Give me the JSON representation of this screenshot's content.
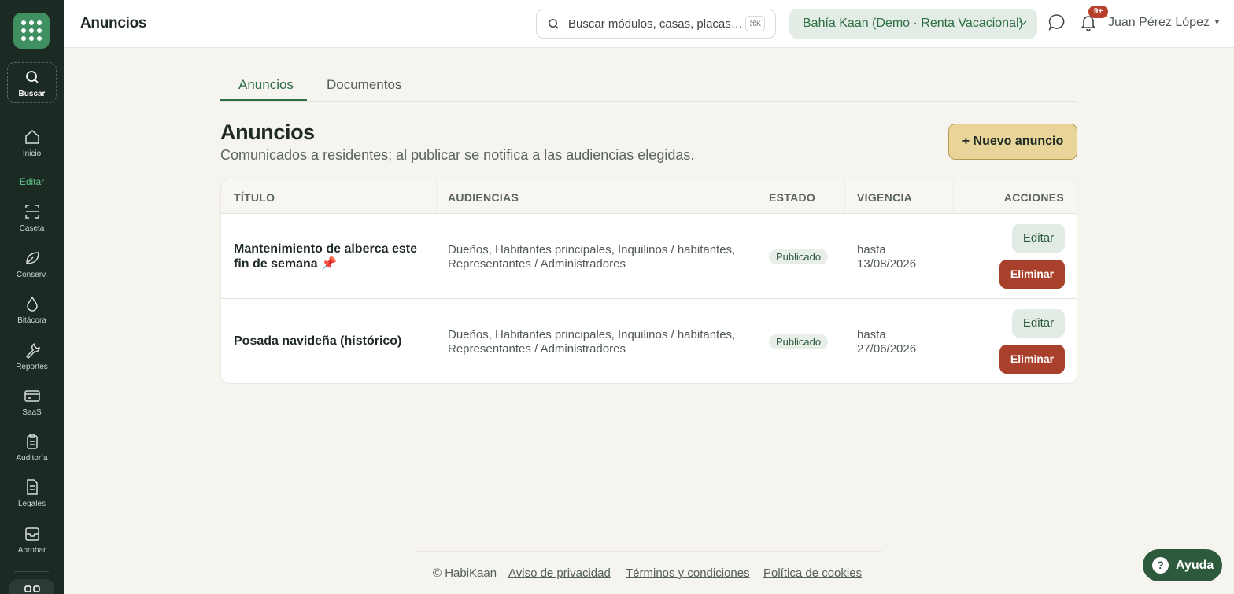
{
  "sidebar": {
    "search_label": "Buscar",
    "items": [
      {
        "label": "Inicio",
        "icon": "home-icon"
      },
      {
        "label": "Caseta",
        "icon": "scan-icon"
      },
      {
        "label": "Conserv.",
        "icon": "leaf-icon"
      },
      {
        "label": "Bitácora",
        "icon": "drop-icon"
      },
      {
        "label": "Reportes",
        "icon": "wrench-icon"
      },
      {
        "label": "SaaS",
        "icon": "card-icon"
      },
      {
        "label": "Auditoría",
        "icon": "clipboard-icon"
      },
      {
        "label": "Legales",
        "icon": "document-icon"
      },
      {
        "label": "Aprobar",
        "icon": "inbox-icon"
      }
    ],
    "section_label": "Editar"
  },
  "header": {
    "title": "Anuncios",
    "search_placeholder": "Buscar módulos, casas, placas…",
    "search_shortcut": "⌘K",
    "org": "Bahía Kaan (Demo · Renta Vacacional)",
    "notifications_badge": "9+",
    "user": "Juan Pérez López"
  },
  "tabs": [
    {
      "label": "Anuncios",
      "active": true
    },
    {
      "label": "Documentos",
      "active": false
    }
  ],
  "page": {
    "heading": "Anuncios",
    "subheading": "Comunicados a residentes; al publicar se notifica a las audiencias elegidas.",
    "new_button": "+ Nuevo anuncio"
  },
  "table": {
    "columns": [
      "TÍTULO",
      "AUDIENCIAS",
      "ESTADO",
      "VIGENCIA",
      "ACCIONES"
    ],
    "rows": [
      {
        "title": "Mantenimiento de alberca este fin de semana 📌",
        "audiences": "Dueños, Habitantes principales, Inquilinos / habitantes, Representantes / Administradores",
        "status": "Publicado",
        "validity": "hasta 13/08/2026",
        "edit": "Editar",
        "delete": "Eliminar"
      },
      {
        "title": "Posada navideña (histórico)",
        "audiences": "Dueños, Habitantes principales, Inquilinos / habitantes, Representantes / Administradores",
        "status": "Publicado",
        "validity": "hasta 27/06/2026",
        "edit": "Editar",
        "delete": "Eliminar"
      }
    ]
  },
  "footer": {
    "copyright": "© HabiKaan",
    "links": [
      "Aviso de privacidad",
      "Términos y condiciones",
      "Política de cookies"
    ]
  },
  "help_button": "Ayuda",
  "colors": {
    "sidebar": "#1b2a23",
    "accent": "#2d6e45",
    "primary_button": "#e9d49a",
    "danger": "#a8402b"
  }
}
